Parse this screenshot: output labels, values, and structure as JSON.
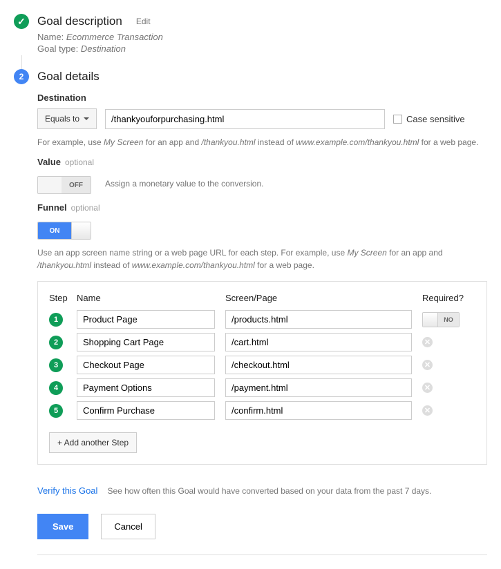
{
  "step1": {
    "title": "Goal description",
    "edit": "Edit",
    "name_label": "Name:",
    "name_value": "Ecommerce Transaction",
    "type_label": "Goal type:",
    "type_value": "Destination"
  },
  "step2": {
    "number": "2",
    "title": "Goal details"
  },
  "destination": {
    "label": "Destination",
    "match": "Equals to",
    "value": "/thankyouforpurchasing.html",
    "case_sensitive": "Case sensitive",
    "hint_prefix": "For example, use ",
    "hint_em1": "My Screen",
    "hint_mid1": " for an app and ",
    "hint_em2": "/thankyou.html",
    "hint_mid2": " instead of ",
    "hint_em3": "www.example.com/thankyou.html",
    "hint_suffix": " for a web page."
  },
  "value": {
    "label": "Value",
    "optional": "optional",
    "off": "OFF",
    "desc": "Assign a monetary value to the conversion."
  },
  "funnel": {
    "label": "Funnel",
    "optional": "optional",
    "on": "ON",
    "hint_prefix": "Use an app screen name string or a web page URL for each step. For example, use ",
    "hint_em1": "My Screen",
    "hint_mid1": " for an app and ",
    "hint_em2": "/thankyou.html",
    "hint_mid2": " instead of ",
    "hint_em3": "www.example.com/thankyou.html",
    "hint_suffix": " for a web page.",
    "headers": {
      "step": "Step",
      "name": "Name",
      "page": "Screen/Page",
      "required": "Required?"
    },
    "required_no": "NO",
    "steps": [
      {
        "n": "1",
        "name": "Product Page",
        "page": "/products.html"
      },
      {
        "n": "2",
        "name": "Shopping Cart Page",
        "page": "/cart.html"
      },
      {
        "n": "3",
        "name": "Checkout Page",
        "page": "/checkout.html"
      },
      {
        "n": "4",
        "name": "Payment Options",
        "page": "/payment.html"
      },
      {
        "n": "5",
        "name": "Confirm Purchase",
        "page": "/confirm.html"
      }
    ],
    "add": "+ Add another Step"
  },
  "verify": {
    "link": "Verify this Goal",
    "desc": "See how often this Goal would have converted based on your data from the past 7 days."
  },
  "buttons": {
    "save": "Save",
    "cancel": "Cancel"
  }
}
